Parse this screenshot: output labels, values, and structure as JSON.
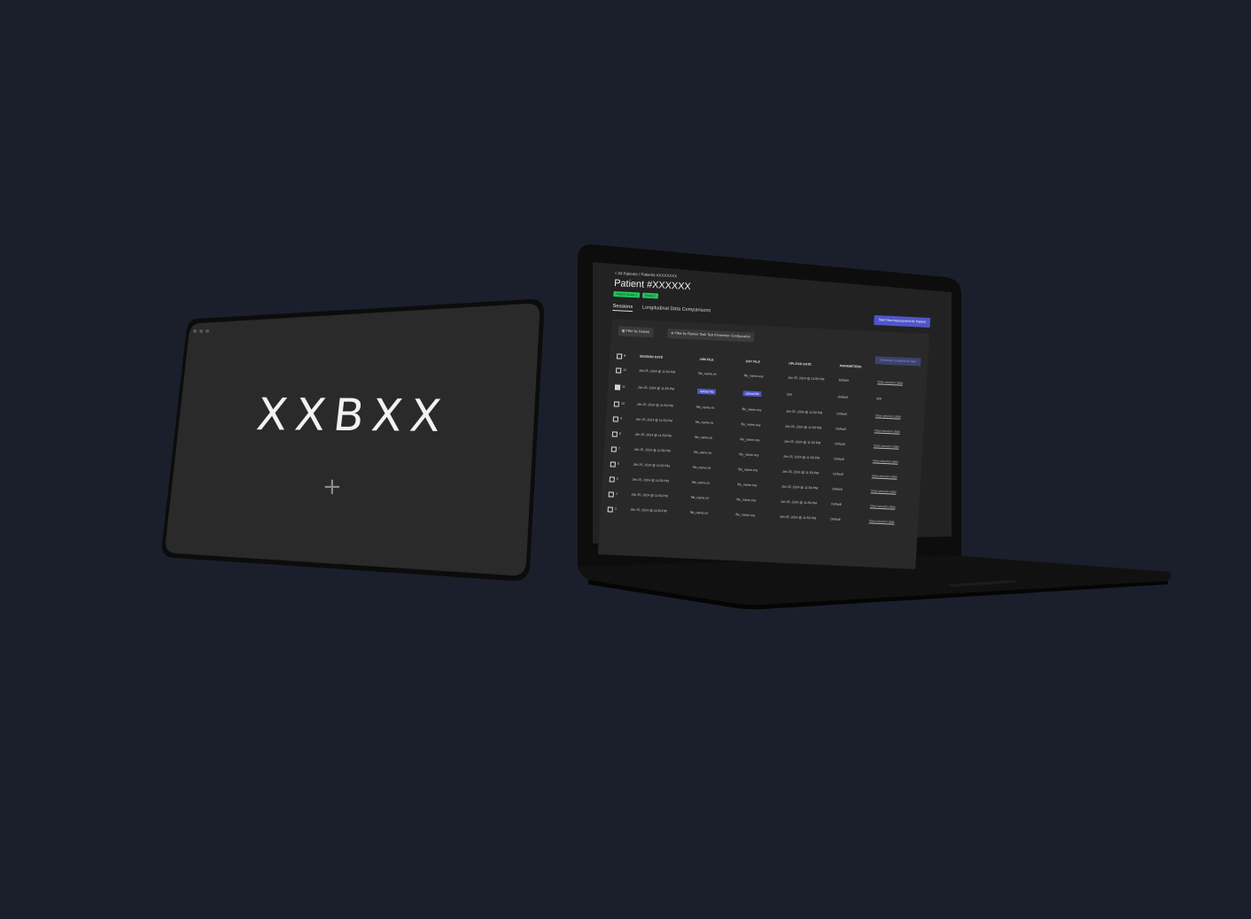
{
  "tablet": {
    "wordmark": "XXBXX",
    "plus_symbol": "+"
  },
  "laptop": {
    "breadcrumb": "< All Patients / Patients #XXXXXXX",
    "patient_title": "Patient #XXXXXX",
    "badges": [
      "Patient Group 1",
      "Group 2"
    ],
    "tabs": [
      "Sessions",
      "Longitudinal Data Comparisons"
    ],
    "start_button": "Start New Assessment for Patient",
    "filter_date": "Filter by Date(s)",
    "filter_params": "Filter by Flanker Task Test Parameter Configuration",
    "download_button": "Download Longitudinal Data",
    "columns": [
      "#",
      "SESSION DATE",
      ".NIM FILE",
      ".OXY FILE",
      "UPLOAD DATE",
      "PARAMETERS"
    ],
    "rows": [
      {
        "num": "12",
        "date": "Jan 25, 2024 @ 11:59 PM",
        "nim": "file_name.nir",
        "oxy": "file_name.oxy",
        "upload": "Jan 25, 2024 @ 11:59 PM",
        "params": "Default",
        "action": "View session data"
      },
      {
        "num": "11",
        "date": "Jan 25, 2024 @ 11:59 PM",
        "nim": "upload file",
        "oxy": "upload file",
        "upload": "N/A",
        "params": "Default",
        "action": "N/A"
      },
      {
        "num": "10",
        "date": "Jan 25, 2024 @ 11:59 PM",
        "nim": "file_name.nir",
        "oxy": "file_name.oxy",
        "upload": "Jan 25, 2024 @ 11:59 PM",
        "params": "Default",
        "action": "View session data"
      },
      {
        "num": "9",
        "date": "Jan 25, 2024 @ 11:59 PM",
        "nim": "file_name.nir",
        "oxy": "file_name.oxy",
        "upload": "Jan 25, 2024 @ 11:59 PM",
        "params": "Default",
        "action": "View session data"
      },
      {
        "num": "8",
        "date": "Jan 25, 2024 @ 11:59 PM",
        "nim": "file_name.nir",
        "oxy": "file_name.oxy",
        "upload": "Jan 25, 2024 @ 11:59 PM",
        "params": "Default",
        "action": "View session data"
      },
      {
        "num": "7",
        "date": "Jan 25, 2024 @ 11:59 PM",
        "nim": "file_name.nir",
        "oxy": "file_name.oxy",
        "upload": "Jan 25, 2024 @ 11:59 PM",
        "params": "Default",
        "action": "View session data"
      },
      {
        "num": "6",
        "date": "Jan 25, 2024 @ 11:59 PM",
        "nim": "file_name.nir",
        "oxy": "file_name.oxy",
        "upload": "Jan 25, 2024 @ 11:59 PM",
        "params": "Default",
        "action": "View session data"
      },
      {
        "num": "5",
        "date": "Jan 25, 2024 @ 11:59 PM",
        "nim": "file_name.nir",
        "oxy": "file_name.oxy",
        "upload": "Jan 25, 2024 @ 11:59 PM",
        "params": "Default",
        "action": "View session data"
      },
      {
        "num": "4",
        "date": "Jan 25, 2024 @ 11:59 PM",
        "nim": "file_name.nir",
        "oxy": "file_name.oxy",
        "upload": "Jan 25, 2024 @ 11:59 PM",
        "params": "Default",
        "action": "View session data"
      },
      {
        "num": "3",
        "date": "Jan 25, 2024 @ 11:59 PM",
        "nim": "file_name.nir",
        "oxy": "file_name.oxy",
        "upload": "Jan 25, 2024 @ 11:59 PM",
        "params": "Default",
        "action": "View session data"
      }
    ]
  }
}
